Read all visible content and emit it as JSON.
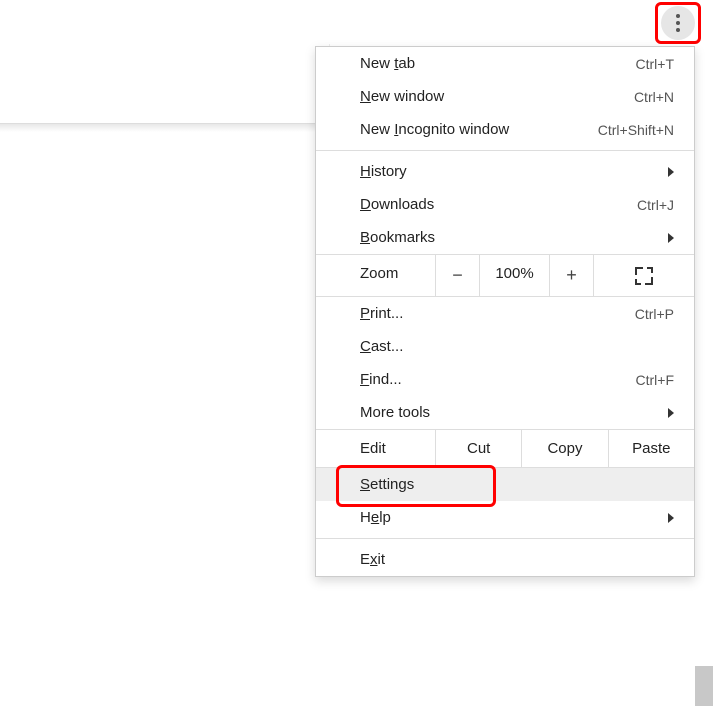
{
  "kebab": {
    "name": "more-options"
  },
  "menu": {
    "new_tab": {
      "label": "New tab",
      "mnemonic_index": 4,
      "shortcut": "Ctrl+T"
    },
    "new_window": {
      "label": "New window",
      "mnemonic_index": 0,
      "shortcut": "Ctrl+N"
    },
    "incognito": {
      "label": "New Incognito window",
      "mnemonic_index": 4,
      "shortcut": "Ctrl+Shift+N"
    },
    "history": {
      "label": "History",
      "mnemonic_index": 0,
      "submenu": true
    },
    "downloads": {
      "label": "Downloads",
      "mnemonic_index": 0,
      "shortcut": "Ctrl+J"
    },
    "bookmarks": {
      "label": "Bookmarks",
      "mnemonic_index": 0,
      "submenu": true
    },
    "zoom": {
      "label": "Zoom",
      "value": "100%",
      "minus": "−",
      "plus": "+"
    },
    "print": {
      "label": "Print...",
      "mnemonic_index": 0,
      "shortcut": "Ctrl+P"
    },
    "cast": {
      "label": "Cast...",
      "mnemonic_index": 0
    },
    "find": {
      "label": "Find...",
      "mnemonic_index": 0,
      "shortcut": "Ctrl+F"
    },
    "more_tools": {
      "label": "More tools",
      "mnemonic_index": null,
      "submenu": true
    },
    "edit": {
      "label": "Edit",
      "cut": "Cut",
      "copy": "Copy",
      "paste": "Paste"
    },
    "settings": {
      "label": "Settings",
      "mnemonic_index": 0,
      "highlighted": true,
      "hover": true
    },
    "help": {
      "label": "Help",
      "mnemonic_index": 1,
      "submenu": true
    },
    "exit": {
      "label": "Exit",
      "mnemonic_index": 1
    }
  },
  "annotations": {
    "kebab_highlight": true,
    "settings_highlight": true
  }
}
